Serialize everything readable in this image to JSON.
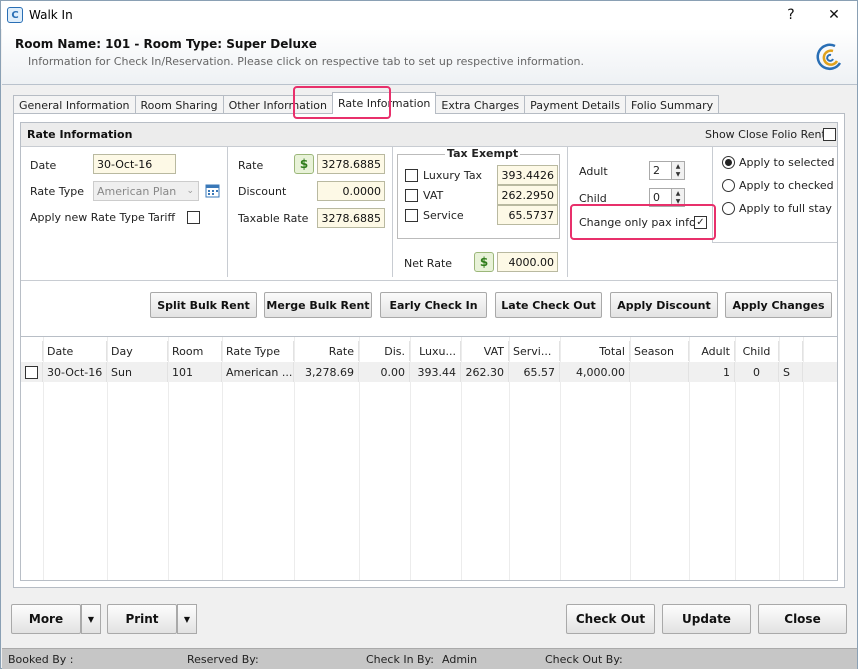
{
  "window": {
    "title": "Walk In",
    "help_glyph": "?",
    "close_glyph": "✕"
  },
  "header": {
    "title": "Room Name: 101 - Room Type: Super Deluxe",
    "subtitle": "Information for Check In/Reservation. Please click on respective tab to set up respective information."
  },
  "tabs": [
    {
      "label": "General Information"
    },
    {
      "label": "Room Sharing"
    },
    {
      "label": "Other Information"
    },
    {
      "label": "Rate Information"
    },
    {
      "label": "Extra Charges"
    },
    {
      "label": "Payment Details"
    },
    {
      "label": "Folio Summary"
    }
  ],
  "rate_info": {
    "title": "Rate Information",
    "show_close_folio_label": "Show Close Folio Rent",
    "date_label": "Date",
    "date_value": "30-Oct-16",
    "rate_type_label": "Rate Type",
    "rate_type_value": "American Plan",
    "apply_new_label": "Apply new Rate Type Tariff",
    "rate_label": "Rate",
    "rate_value": "3278.6885",
    "discount_label": "Discount",
    "discount_value": "0.0000",
    "taxable_label": "Taxable Rate",
    "taxable_value": "3278.6885",
    "tax_exempt_title": "Tax Exempt",
    "luxury_label": "Luxury Tax",
    "luxury_value": "393.4426",
    "vat_label": "VAT",
    "vat_value": "262.2950",
    "service_label": "Service",
    "service_value": "65.5737",
    "net_rate_label": "Net Rate",
    "net_rate_value": "4000.00",
    "adult_label": "Adult",
    "adult_value": "2",
    "child_label": "Child",
    "child_value": "0",
    "change_pax_label": "Change only pax info.",
    "check_glyph": "✓",
    "apply_selected": "Apply to selected",
    "apply_checked": "Apply to checked",
    "apply_full": "Apply to full stay"
  },
  "action_buttons": {
    "split": "Split Bulk Rent",
    "merge": "Merge Bulk Rent",
    "early": "Early Check In",
    "late": "Late Check Out",
    "discount": "Apply Discount",
    "changes": "Apply Changes"
  },
  "grid": {
    "headers": [
      "Date",
      "Day",
      "Room",
      "Rate Type",
      "Rate",
      "Dis.",
      "Luxu...",
      "VAT",
      "Servi...",
      "Total",
      "Season",
      "Adult",
      "Child"
    ],
    "row": [
      "30-Oct-16",
      "Sun",
      "101",
      "American ...",
      "3,278.69",
      "0.00",
      "393.44",
      "262.30",
      "65.57",
      "4,000.00",
      "",
      "1",
      "0",
      "S"
    ]
  },
  "footer": {
    "more": "More",
    "print": "Print",
    "dropdown_glyph": "▼",
    "check_out": "Check Out",
    "update": "Update",
    "close": "Close"
  },
  "status": {
    "booked_by": "Booked By :",
    "reserved_by": "Reserved By:",
    "check_in_by": "Check In By:",
    "check_in_by_value": "Admin",
    "check_out_by": "Check Out By:"
  },
  "colors": {
    "highlight": "#e8306b",
    "input_bg": "#fdf9e6",
    "accent": "#2a6fb5"
  }
}
